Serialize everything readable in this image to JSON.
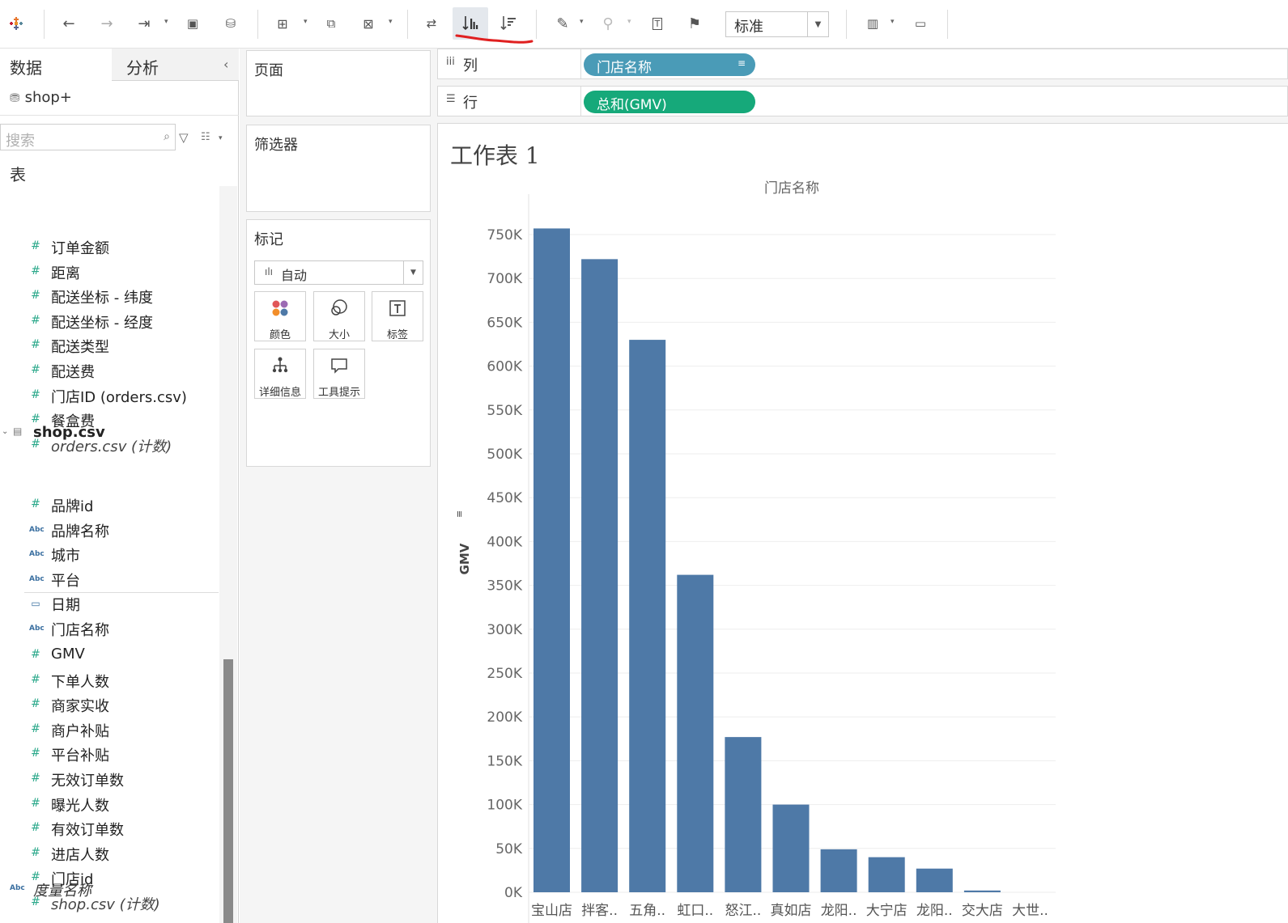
{
  "toolbar": {
    "view_select": "标准",
    "icons": [
      "tableau-logo-icon",
      "undo-icon",
      "redo-icon",
      "replay-icon",
      "save-icon",
      "new-datasource-icon",
      "new-sheet-icon",
      "duplicate-sheet-icon",
      "clear-sheet-icon",
      "swap-icon",
      "sort-ascending-icon",
      "sort-descending-icon",
      "highlight-icon",
      "group-icon",
      "show-labels-icon",
      "pin-icon",
      "show-me-icon",
      "presentation-icon"
    ]
  },
  "data_pane": {
    "tab_data": "数据",
    "tab_analysis": "分析",
    "datasource": "shop+",
    "search_placeholder": "搜索",
    "tables_heading": "表",
    "orders_fields": [
      {
        "type": "measure",
        "label": "订单金额"
      },
      {
        "type": "measure",
        "label": "距离"
      },
      {
        "type": "measure",
        "label": "配送坐标 - 纬度"
      },
      {
        "type": "measure",
        "label": "配送坐标 - 经度"
      },
      {
        "type": "measure",
        "label": "配送类型"
      },
      {
        "type": "measure",
        "label": "配送费"
      },
      {
        "type": "measure",
        "label": "门店ID (orders.csv)"
      },
      {
        "type": "measure",
        "label": "餐盒费"
      },
      {
        "type": "count",
        "label": "orders.csv (计数)"
      }
    ],
    "shop_table": "shop.csv",
    "shop_dimensions": [
      {
        "type": "measure",
        "label": "品牌id"
      },
      {
        "type": "abc",
        "label": "品牌名称"
      },
      {
        "type": "abc",
        "label": "城市"
      },
      {
        "type": "abc",
        "label": "平台"
      },
      {
        "type": "date",
        "label": "日期"
      },
      {
        "type": "abc",
        "label": "门店名称"
      }
    ],
    "shop_measures": [
      {
        "type": "measure",
        "label": "GMV"
      },
      {
        "type": "measure",
        "label": "下单人数"
      },
      {
        "type": "measure",
        "label": "商家实收"
      },
      {
        "type": "measure",
        "label": "商户补贴"
      },
      {
        "type": "measure",
        "label": "平台补贴"
      },
      {
        "type": "measure",
        "label": "无效订单数"
      },
      {
        "type": "measure",
        "label": "曝光人数"
      },
      {
        "type": "measure",
        "label": "有效订单数"
      },
      {
        "type": "measure",
        "label": "进店人数"
      },
      {
        "type": "measure",
        "label": "门店id"
      },
      {
        "type": "count",
        "label": "shop.csv (计数)"
      }
    ],
    "measure_names": "度量名称",
    "abc_glyph": "Abc"
  },
  "cards": {
    "pages": "页面",
    "filters": "筛选器",
    "marks": "标记",
    "marks_type": "自动",
    "mark_buttons": [
      "颜色",
      "大小",
      "标签",
      "详细信息",
      "工具提示"
    ]
  },
  "shelves": {
    "columns_label": "列",
    "columns_pill": "门店名称",
    "rows_label": "行",
    "rows_pill": "总和(GMV)"
  },
  "sheet_title": "工作表 1",
  "colors": {
    "bar": "#4e79a7",
    "dimension_pill": "#4a9bb7",
    "measure_pill": "#16a97a",
    "sort_highlight": "#e02020"
  },
  "chart_data": {
    "type": "bar",
    "title": "门店名称",
    "ylabel": "GMV",
    "categories": [
      "宝山店",
      "拌客..",
      "五角..",
      "虹口..",
      "怒江..",
      "真如店",
      "龙阳..",
      "大宁店",
      "龙阳..",
      "交大店",
      "大世.."
    ],
    "values": [
      757000,
      722000,
      630000,
      362000,
      177000,
      100000,
      49000,
      40000,
      27000,
      2000,
      0
    ],
    "ylim": [
      0,
      750000
    ],
    "yticks": [
      "0K",
      "50K",
      "100K",
      "150K",
      "200K",
      "250K",
      "300K",
      "350K",
      "400K",
      "450K",
      "500K",
      "550K",
      "600K",
      "650K",
      "700K",
      "750K"
    ],
    "ytick_values": [
      0,
      50000,
      100000,
      150000,
      200000,
      250000,
      300000,
      350000,
      400000,
      450000,
      500000,
      550000,
      600000,
      650000,
      700000,
      750000
    ],
    "grid": true,
    "sort": "descending"
  }
}
